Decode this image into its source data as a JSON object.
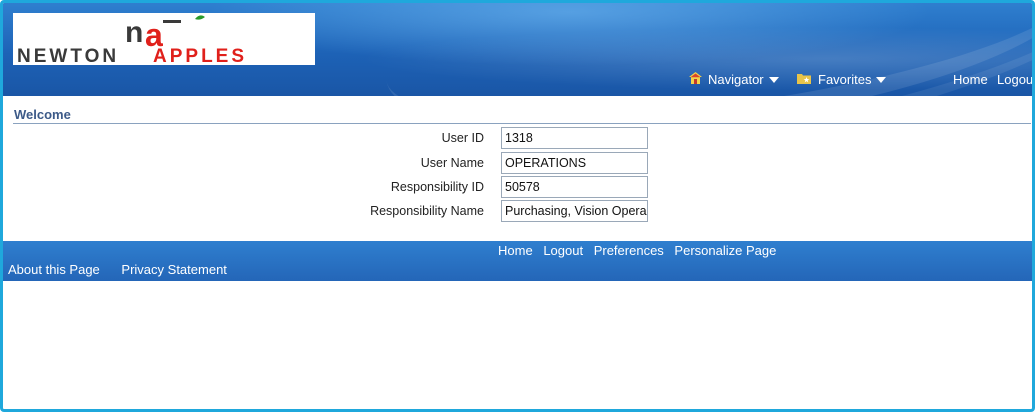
{
  "brand": {
    "logo_mark": "nā",
    "logo_word1": "NEWTON",
    "logo_word2": "APPLES"
  },
  "header": {
    "navigator_label": "Navigator",
    "favorites_label": "Favorites",
    "home_label": "Home",
    "logout_label": "Logout"
  },
  "welcome": {
    "title": "Welcome",
    "fields": [
      {
        "label": "User ID",
        "value": "1318"
      },
      {
        "label": "User Name",
        "value": "OPERATIONS"
      },
      {
        "label": "Responsibility ID",
        "value": "50578"
      },
      {
        "label": "Responsibility Name",
        "value": "Purchasing, Vision Opera"
      }
    ]
  },
  "footer": {
    "links": [
      "Home",
      "Logout",
      "Preferences",
      "Personalize Page"
    ],
    "secondary_links": [
      "About this Page",
      "Privacy Statement"
    ]
  },
  "colors": {
    "banner": "#1d62b6",
    "frame_border": "#1fa8dc",
    "section_title": "#3c5a88",
    "logo_red": "#e0201b",
    "logo_dark": "#3a3a3a"
  },
  "icons": {
    "navigator": "home-icon",
    "favorites": "favorites-folder-icon"
  }
}
